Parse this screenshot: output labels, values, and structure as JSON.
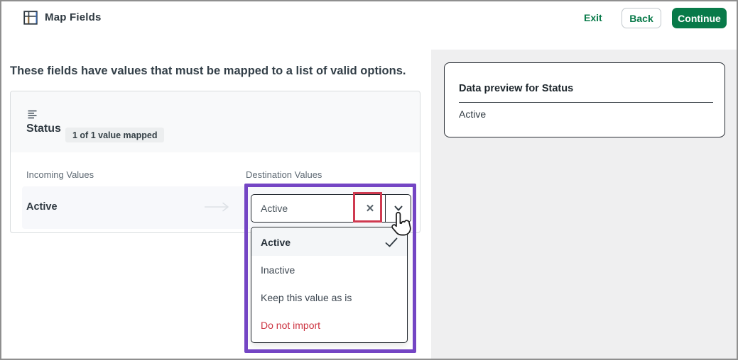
{
  "header": {
    "title": "Map Fields",
    "actions": {
      "exit": "Exit",
      "back": "Back",
      "continue": "Continue"
    }
  },
  "main": {
    "heading": "These fields have values that must be mapped to a list of valid options.",
    "field_card": {
      "name": "Status",
      "badge": "1 of 1 value mapped",
      "columns": {
        "incoming": "Incoming Values",
        "destination": "Destination Values"
      },
      "row": {
        "incoming_value": "Active",
        "destination_value": "Active"
      }
    },
    "dropdown": {
      "selected_index": 0,
      "options": [
        {
          "label": "Active"
        },
        {
          "label": "Inactive"
        },
        {
          "label": "Keep this value as is"
        },
        {
          "label": "Do not import"
        }
      ]
    }
  },
  "preview_panel": {
    "title": "Data preview for Status",
    "value": "Active"
  },
  "icons": {
    "close": "✕"
  },
  "colors": {
    "accent_green": "#087a49",
    "danger_red": "#cc3340",
    "annotation_purple": "#7445c4",
    "annotation_red": "#cf3a50",
    "text_dark": "#2f3941",
    "muted_label": "#5f6a74",
    "panel_gray": "#efeff0",
    "row_bg": "#f7f8fb"
  }
}
